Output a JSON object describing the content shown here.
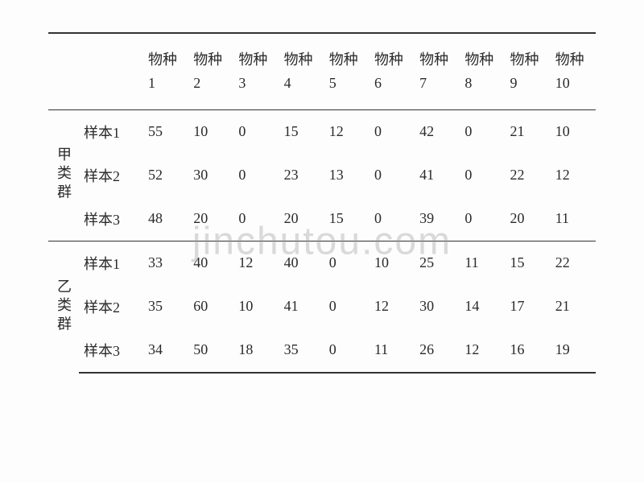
{
  "chart_data": {
    "type": "table",
    "columns": [
      "物种1",
      "物种2",
      "物种3",
      "物种4",
      "物种5",
      "物种6",
      "物种7",
      "物种8",
      "物种9",
      "物种10"
    ],
    "groups": [
      {
        "name": "甲类群",
        "rows": [
          {
            "label": "样本1",
            "values": [
              55,
              10,
              0,
              15,
              12,
              0,
              42,
              0,
              21,
              10
            ]
          },
          {
            "label": "样本2",
            "values": [
              52,
              30,
              0,
              23,
              13,
              0,
              41,
              0,
              22,
              12
            ]
          },
          {
            "label": "样本3",
            "values": [
              48,
              20,
              0,
              20,
              15,
              0,
              39,
              0,
              20,
              11
            ]
          }
        ]
      },
      {
        "name": "乙类群",
        "rows": [
          {
            "label": "样本1",
            "values": [
              33,
              40,
              12,
              40,
              0,
              10,
              25,
              11,
              15,
              22
            ]
          },
          {
            "label": "样本2",
            "values": [
              35,
              60,
              10,
              41,
              0,
              12,
              30,
              14,
              17,
              21
            ]
          },
          {
            "label": "样本3",
            "values": [
              34,
              50,
              18,
              35,
              0,
              11,
              26,
              12,
              16,
              19
            ]
          }
        ]
      }
    ]
  },
  "header_prefix": "物种",
  "watermark": "jinchutou.com"
}
